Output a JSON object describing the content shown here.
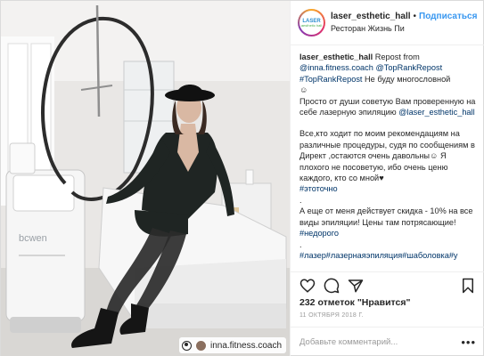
{
  "photo": {
    "alt_subject": "woman in black dress and hat seated on cosmetology chair next to laser machine",
    "device_brand": "bcwen",
    "tag_label": "inna.fitness.coach"
  },
  "header": {
    "avatar_line1": "LASER",
    "avatar_line2": "aesthetic hall",
    "username": "laser_esthetic_hall",
    "separator": "•",
    "follow_label": "Подписаться",
    "location": "Ресторан Жизнь Пи"
  },
  "caption": {
    "username": "laser_esthetic_hall",
    "repost_from": " Repost from ",
    "mention1": "@inna.fitness.coach",
    "mention2": "@TopRankRepost",
    "hashtag1": "#TopRankRepost",
    "line_after": " Не буду многословной",
    "emoji": "☺",
    "para1a": "Просто от души советую Вам проверенную на себе лазерную эпиляцию ",
    "mention3": "@laser_esthetic_hall",
    "para2": "Все,кто ходит по моим рекомендациям на различные процедуры, судя по сообщениям в Директ ,остаются очень давольны☺ Я плохого не посоветую, ибо очень ценю каждого, кто со мной♥",
    "hashtag2": "#этоточно",
    "dot": ".",
    "para3a": "А еще от меня действует скидка - 10% на все виды эпиляции! Цены там потрясающие! ",
    "hashtag3": "#недорого",
    "para4": "#лазер#лазернаяэпиляция#шаболовка#у"
  },
  "likes": {
    "count": "232",
    "text": " отметок ",
    "quote": "\"Нравится\""
  },
  "date": "11 ОКТЯБРЯ 2018 Г.",
  "comment": {
    "placeholder": "Добавьте комментарий...",
    "more": "•••"
  },
  "icons": [
    "heart-icon",
    "comment-icon",
    "share-icon",
    "bookmark-icon",
    "person-tag-icon"
  ],
  "colors": {
    "link": "#003569",
    "follow": "#3897f0",
    "muted": "#999999",
    "border": "#efefef"
  }
}
